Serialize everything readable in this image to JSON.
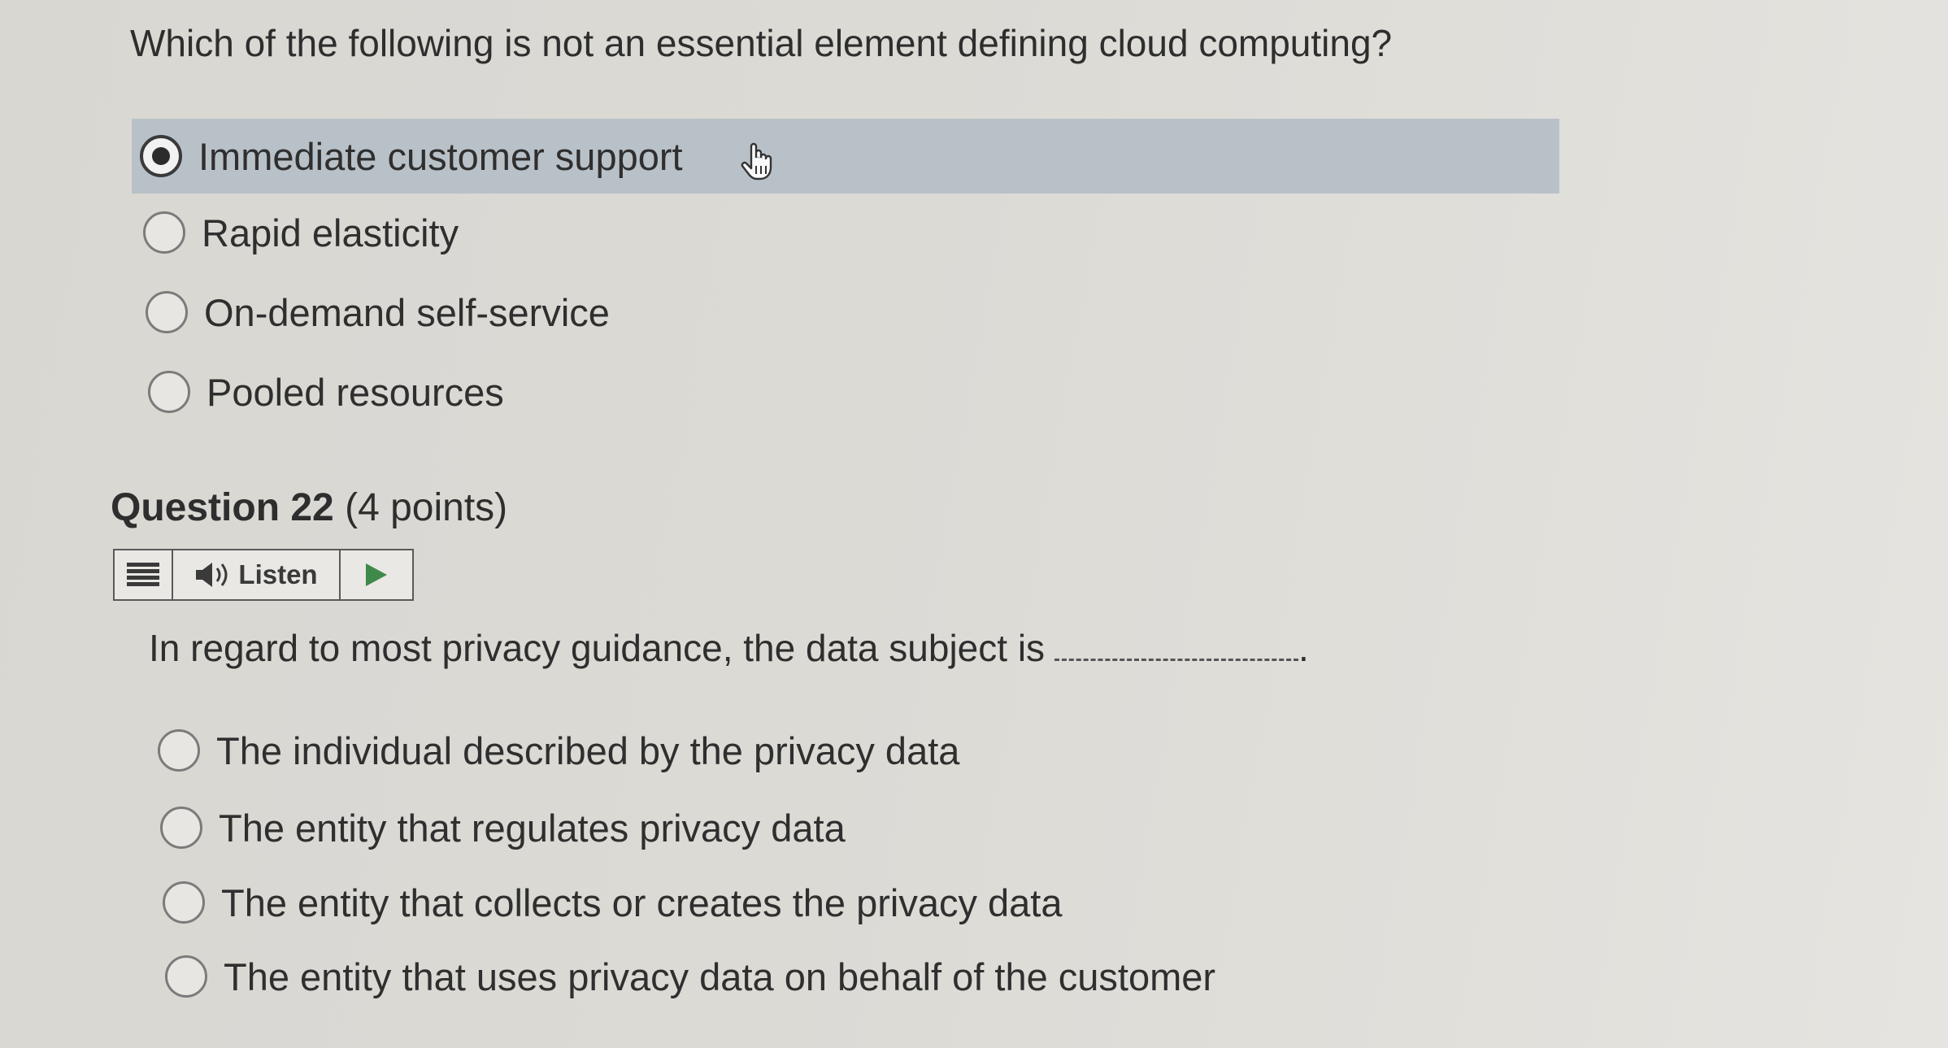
{
  "question_prev": {
    "prompt": "Which of the following is not an essential element defining cloud computing?",
    "options": [
      {
        "label": "Immediate customer support",
        "selected": true
      },
      {
        "label": "Rapid elasticity",
        "selected": false
      },
      {
        "label": "On-demand self-service",
        "selected": false
      },
      {
        "label": "Pooled resources",
        "selected": false
      }
    ]
  },
  "question_22": {
    "title": "Question 22",
    "points": "(4 points)",
    "listen_label": "Listen",
    "prompt": "In regard to most privacy guidance, the data subject is",
    "prompt_end": ".",
    "options": [
      {
        "label": "The individual described by the privacy data",
        "selected": false
      },
      {
        "label": "The entity that regulates privacy data",
        "selected": false
      },
      {
        "label": "The entity that collects or creates the privacy data",
        "selected": false
      },
      {
        "label": "The entity that uses privacy data on behalf of the customer",
        "selected": false
      }
    ]
  },
  "colors": {
    "selected_row": "#b9c1c8",
    "play_icon": "#3f8a4a"
  },
  "icons": [
    "menu-icon",
    "speaker-icon",
    "play-icon",
    "hand-cursor-icon"
  ]
}
